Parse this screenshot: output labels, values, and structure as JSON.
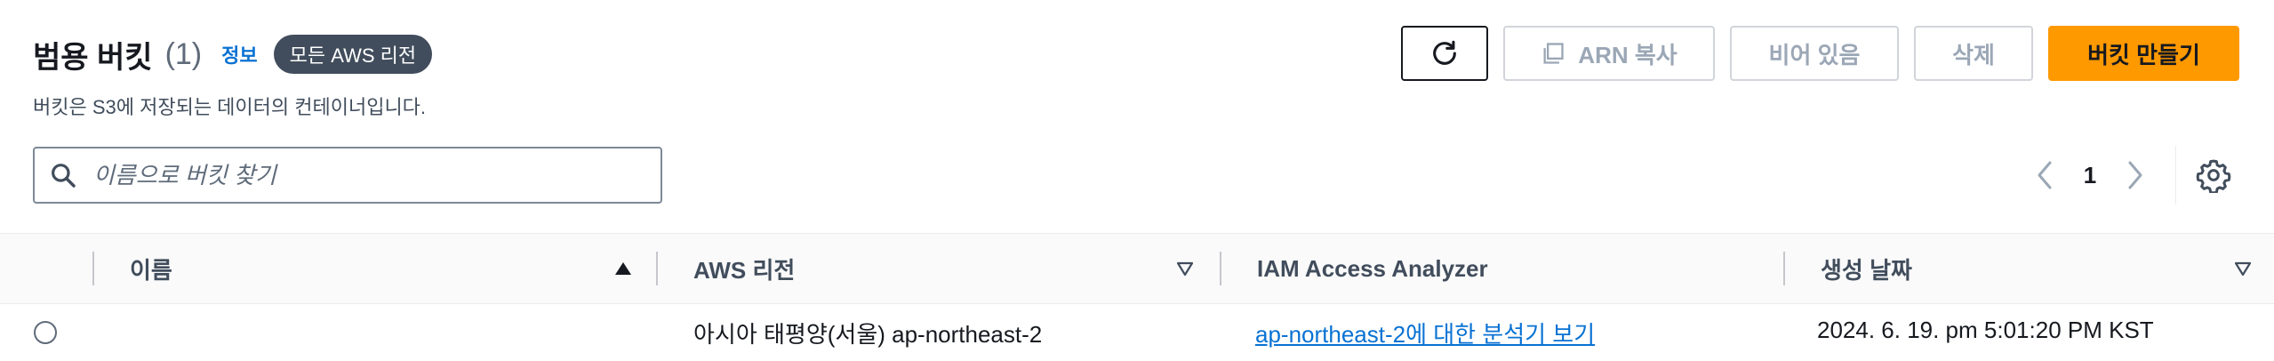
{
  "header": {
    "title": "범용 버킷",
    "count": "(1)",
    "info_link": "정보",
    "region_badge": "모든 AWS 리전",
    "description": "버킷은 S3에 저장되는 데이터의 컨테이너입니다."
  },
  "actions": {
    "refresh_icon": "refresh-icon",
    "copy_arn": "ARN 복사",
    "copy_icon": "copy-icon",
    "empty": "비어 있음",
    "delete": "삭제",
    "create": "버킷 만들기"
  },
  "search": {
    "placeholder": "이름으로 버킷 찾기",
    "value": ""
  },
  "pagination": {
    "current_page": "1"
  },
  "table": {
    "columns": [
      "이름",
      "AWS 리전",
      "IAM Access Analyzer",
      "생성 날짜"
    ],
    "rows": [
      {
        "name": "",
        "region": "아시아 태평양(서울) ap-northeast-2",
        "analyzer_link": "ap-northeast-2에 대한 분석기 보기",
        "created": "2024. 6. 19. pm 5:01:20 PM KST"
      }
    ]
  },
  "colors": {
    "primary_orange": "#ff9900",
    "link_blue": "#0972d3",
    "badge_bg": "#414d5c",
    "disabled_text": "#9ba7b6"
  }
}
